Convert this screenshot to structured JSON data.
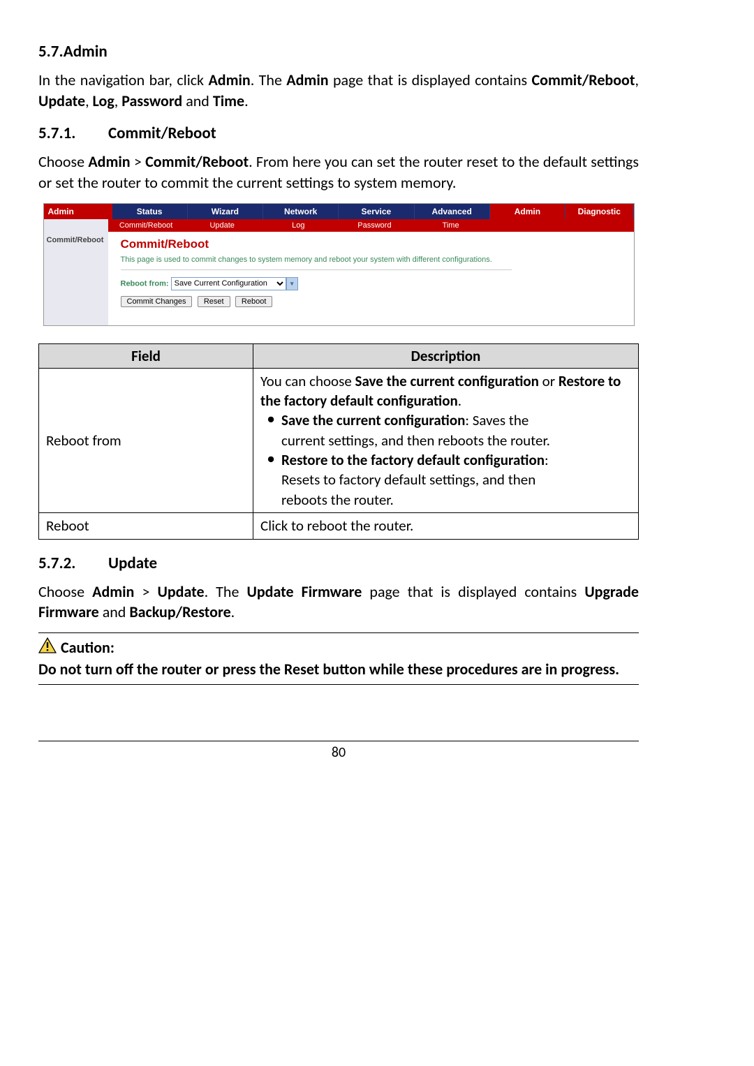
{
  "section": {
    "num": "5.7.",
    "title": "Admin"
  },
  "intro": {
    "p1a": "In the navigation bar, click ",
    "p1b": "Admin",
    "p1c": ". The ",
    "p1d": "Admin",
    "p1e": " page that is displayed contains ",
    "p1f": "Commit/Reboot",
    "p1g": ", ",
    "p1h": "Update",
    "p1i": ", ",
    "p1j": "Log",
    "p1k": ", ",
    "p1l": "Password",
    "p1m": " and ",
    "p1n": "Time",
    "p1o": "."
  },
  "sub1": {
    "num": "5.7.1.",
    "title": "Commit/Reboot"
  },
  "sub1text": {
    "a": "Choose ",
    "b": "Admin",
    "c": " > ",
    "d": "Commit/Reboot",
    "e": ". From here you can set the router reset to the default settings or set the router to commit the current settings to system memory."
  },
  "router": {
    "left": "Admin",
    "top": [
      "Status",
      "Wizard",
      "Network",
      "Service",
      "Advanced",
      "Admin",
      "Diagnostic"
    ],
    "sub": [
      "Commit/Reboot",
      "Update",
      "Log",
      "Password",
      "Time"
    ],
    "sideItem": "Commit/Reboot",
    "panelTitle": "Commit/Reboot",
    "panelDesc": "This page is used to commit changes to system memory and reboot your system with different configurations.",
    "rebootFromLabel": "Reboot from:",
    "rebootFromValue": "Save Current Configuration",
    "buttons": [
      "Commit Changes",
      "Reset",
      "Reboot"
    ]
  },
  "table": {
    "h1": "Field",
    "h2": "Description",
    "r1f": "Reboot from",
    "r1d_a": "You can choose ",
    "r1d_b": "Save the current configuration",
    "r1d_c": " or ",
    "r1d_d": "Restore to the factory default configuration",
    "r1d_e": ".",
    "r1_bul1_b": "Save the current configuration",
    "r1_bul1_t": ": Saves the",
    "r1_bul1_cont": "current settings, and then reboots the router.",
    "r1_bul2_b": "Restore to the factory default configuration",
    "r1_bul2_t": ":",
    "r1_bul2_cont1": "Resets to factory default settings, and then",
    "r1_bul2_cont2": "reboots the router.",
    "r2f": "Reboot",
    "r2d": "Click to reboot the router."
  },
  "sub2": {
    "num": "5.7.2.",
    "title": "Update"
  },
  "sub2text": {
    "a": "Choose ",
    "b": "Admin",
    "c": " > ",
    "d": "Update",
    "e": ". The ",
    "f": "Update Firmware",
    "g": " page that is displayed contains ",
    "h": "Upgrade Firmware",
    "i": " and ",
    "j": "Backup/Restore",
    "k": "."
  },
  "caution": {
    "head": "Caution:",
    "body": "Do not turn off the router or press the Reset button while these procedures are in progress."
  },
  "page": "80"
}
